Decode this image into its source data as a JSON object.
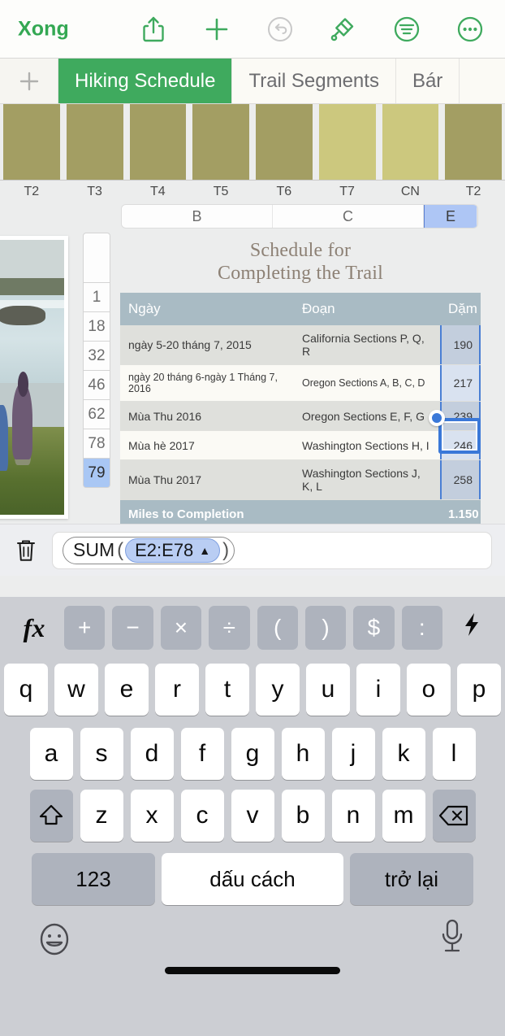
{
  "toolbar": {
    "done_label": "Xong",
    "icons": [
      {
        "name": "share-icon",
        "label": "Share"
      },
      {
        "name": "insert-icon",
        "label": "Insert"
      },
      {
        "name": "undo-icon",
        "label": "Undo",
        "disabled": true
      },
      {
        "name": "format-brush-icon",
        "label": "Format"
      },
      {
        "name": "organize-icon",
        "label": "Organize"
      },
      {
        "name": "more-icon",
        "label": "More"
      }
    ],
    "accent_color": "#3faa5e",
    "disabled_color": "#c3c3c3"
  },
  "tabs": {
    "add_label": "+",
    "items": [
      {
        "label": "Hiking Schedule",
        "active": true
      },
      {
        "label": "Trail Segments",
        "active": false
      },
      {
        "label": "Bár",
        "active": false
      }
    ]
  },
  "chart_data": {
    "type": "bar",
    "title": "",
    "categories": [
      "T2",
      "T3",
      "T4",
      "T5",
      "T6",
      "T7",
      "CN",
      "T2"
    ],
    "values": [
      100,
      100,
      100,
      100,
      100,
      100,
      100,
      100
    ],
    "colors": [
      "#a39e63",
      "#a39e63",
      "#a39e63",
      "#a39e63",
      "#a39e63",
      "#ccc87e",
      "#ccc87e",
      "#a39e63"
    ],
    "xlabel": "",
    "ylabel": "",
    "grid": false,
    "legend": "none"
  },
  "column_headers": {
    "items": [
      {
        "label": "B",
        "selected": false,
        "width": 42
      },
      {
        "label": "C",
        "selected": false,
        "width": 42
      },
      {
        "label": "E",
        "selected": true,
        "width": 16
      }
    ]
  },
  "row_gutter": {
    "rows": [
      {
        "label": "",
        "selected": false
      },
      {
        "label": "1",
        "selected": false
      },
      {
        "label": "18",
        "selected": false
      },
      {
        "label": "32",
        "selected": false
      },
      {
        "label": "46",
        "selected": false
      },
      {
        "label": "62",
        "selected": false
      },
      {
        "label": "78",
        "selected": false
      },
      {
        "label": "79",
        "selected": true
      }
    ]
  },
  "table": {
    "title_line1": "Schedule for",
    "title_line2": "Completing the Trail",
    "headers": [
      "Ngày",
      "Đoạn",
      "Dặm"
    ],
    "rows": [
      {
        "date": "ngày 5-20 tháng 7, 2015",
        "section": "California Sections P, Q, R",
        "miles": "190"
      },
      {
        "date": "ngày 20 tháng 6-ngày 1 Tháng 7, 2016",
        "section": "Oregon Sections A, B, C, D",
        "miles": "217"
      },
      {
        "date": "Mùa Thu 2016",
        "section": "Oregon Sections E, F, G",
        "miles": "239"
      },
      {
        "date": "Mùa hè 2017",
        "section": "Washington Sections H, I",
        "miles": "246"
      },
      {
        "date": "Mùa Thu 2017",
        "section": "Washington Sections J, K, L",
        "miles": "258"
      }
    ],
    "total_label": "Miles to Completion",
    "total_value": "1.150",
    "header_bg": "#a9bbc4",
    "selection_color": "#3a78d8"
  },
  "formula_bar": {
    "trash_icon": "trash-icon",
    "function_name": "SUM",
    "open_paren": "(",
    "range": "E2:E78",
    "range_arrow": "▲",
    "close_paren": ")"
  },
  "keyboard": {
    "symbol_row": {
      "fx": "fx",
      "keys": [
        "+",
        "−",
        "×",
        "÷",
        "(",
        ")",
        "$",
        ":"
      ],
      "bolt": "⚡"
    },
    "row1": [
      "q",
      "w",
      "e",
      "r",
      "t",
      "y",
      "u",
      "i",
      "o",
      "p"
    ],
    "row2": [
      "a",
      "s",
      "d",
      "f",
      "g",
      "h",
      "j",
      "k",
      "l"
    ],
    "row3": [
      "z",
      "x",
      "c",
      "v",
      "b",
      "n",
      "m"
    ],
    "shift_label": "shift",
    "backspace_label": "delete",
    "numbers_label": "123",
    "space_label": "dấu cách",
    "return_label": "trở lại",
    "emoji_icon": "emoji-icon",
    "mic_icon": "microphone-icon"
  }
}
